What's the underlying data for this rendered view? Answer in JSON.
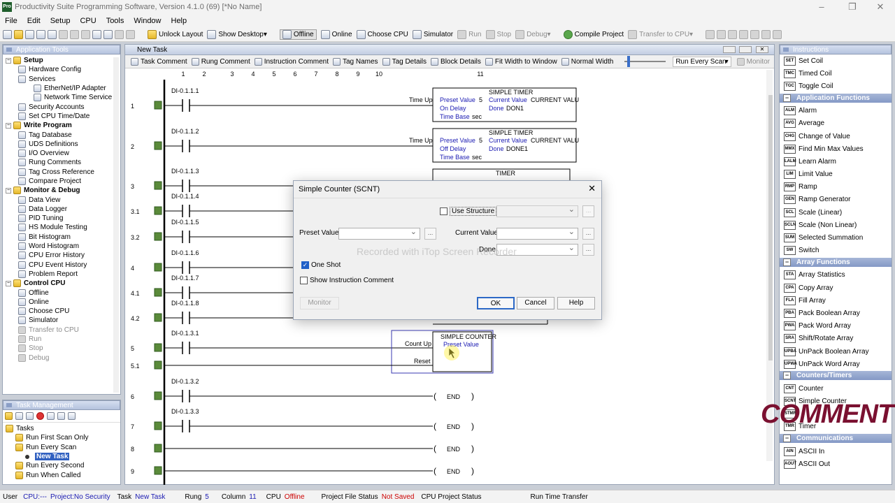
{
  "window": {
    "title": "Productivity Suite Programming Software, Version 4.1.0 (69)   [*No Name]",
    "app_icon": "Pro"
  },
  "menu": [
    "File",
    "Edit",
    "Setup",
    "CPU",
    "Tools",
    "Window",
    "Help"
  ],
  "toolbar": {
    "unlock_layout": "Unlock Layout",
    "show_desktop": "Show Desktop",
    "offline": "Offline",
    "online": "Online",
    "choose_cpu": "Choose CPU",
    "simulator": "Simulator",
    "run": "Run",
    "stop": "Stop",
    "debug": "Debug",
    "compile": "Compile Project",
    "transfer": "Transfer to CPU"
  },
  "app_tools": {
    "title": "Application Tools",
    "items": [
      {
        "label": "Setup",
        "group": true
      },
      {
        "label": "Hardware Config",
        "group": false,
        "level": 2
      },
      {
        "label": "Services",
        "group": false,
        "level": 2
      },
      {
        "label": "EtherNet/IP Adapter",
        "group": false,
        "level": 3
      },
      {
        "label": "Network Time Service",
        "group": false,
        "level": 3
      },
      {
        "label": "Security Accounts",
        "group": false,
        "level": 2
      },
      {
        "label": "Set CPU Time/Date",
        "group": false,
        "level": 2
      },
      {
        "label": "Write Program",
        "group": true
      },
      {
        "label": "Tag Database",
        "group": false,
        "level": 2
      },
      {
        "label": "UDS Definitions",
        "group": false,
        "level": 2
      },
      {
        "label": "I/O Overview",
        "group": false,
        "level": 2
      },
      {
        "label": "Rung Comments",
        "group": false,
        "level": 2
      },
      {
        "label": "Tag Cross Reference",
        "group": false,
        "level": 2
      },
      {
        "label": "Compare Project",
        "group": false,
        "level": 2
      },
      {
        "label": "Monitor & Debug",
        "group": true
      },
      {
        "label": "Data View",
        "group": false,
        "level": 2
      },
      {
        "label": "Data Logger",
        "group": false,
        "level": 2
      },
      {
        "label": "PID Tuning",
        "group": false,
        "level": 2
      },
      {
        "label": "HS Module Testing",
        "group": false,
        "level": 2
      },
      {
        "label": "Bit Histogram",
        "group": false,
        "level": 2
      },
      {
        "label": "Word Histogram",
        "group": false,
        "level": 2
      },
      {
        "label": "CPU Error History",
        "group": false,
        "level": 2
      },
      {
        "label": "CPU Event History",
        "group": false,
        "level": 2
      },
      {
        "label": "Problem Report",
        "group": false,
        "level": 2
      },
      {
        "label": "Control CPU",
        "group": true
      },
      {
        "label": "Offline",
        "group": false,
        "level": 2
      },
      {
        "label": "Online",
        "group": false,
        "level": 2
      },
      {
        "label": "Choose CPU",
        "group": false,
        "level": 2
      },
      {
        "label": "Simulator",
        "group": false,
        "level": 2
      },
      {
        "label": "Transfer to CPU",
        "group": false,
        "level": 2,
        "disabled": true
      },
      {
        "label": "Run",
        "group": false,
        "level": 2,
        "disabled": true
      },
      {
        "label": "Stop",
        "group": false,
        "level": 2,
        "disabled": true
      },
      {
        "label": "Debug",
        "group": false,
        "level": 2,
        "disabled": true
      }
    ]
  },
  "task_mgmt": {
    "title": "Task Management",
    "items": [
      {
        "label": "Tasks",
        "level": 1
      },
      {
        "label": "Run First Scan Only",
        "level": 2
      },
      {
        "label": "Run Every Scan",
        "level": 2
      },
      {
        "label": "New Task",
        "level": 3,
        "selected": true
      },
      {
        "label": "Run Every Second",
        "level": 2
      },
      {
        "label": "Run When Called",
        "level": 2
      }
    ]
  },
  "editor": {
    "title": "New Task",
    "toolbar": [
      "Task Comment",
      "Rung Comment",
      "Instruction Comment",
      "Tag Names",
      "Tag Details",
      "Block Details",
      "Fit Width to Window",
      "Normal Width"
    ],
    "scan_select": "Run Every Scan",
    "monitor": "Monitor",
    "columns": [
      "1",
      "2",
      "3",
      "4",
      "5",
      "6",
      "7",
      "8",
      "9",
      "10",
      "11"
    ],
    "rungs": [
      {
        "num": "1",
        "contact": "DI-0.1.1.1"
      },
      {
        "num": "2",
        "contact": "DI-0.1.1.2"
      },
      {
        "num": "3",
        "contact": "DI-0.1.1.3"
      },
      {
        "num": "3.1",
        "contact": "DI-0.1.1.4"
      },
      {
        "num": "3.2",
        "contact": "DI-0.1.1.5"
      },
      {
        "num": "4",
        "contact": "DI-0.1.1.6"
      },
      {
        "num": "4.1",
        "contact": "DI-0.1.1.7"
      },
      {
        "num": "4.2",
        "contact": "DI-0.1.1.8"
      },
      {
        "num": "5",
        "contact": "DI-0.1.3.1"
      },
      {
        "num": "5.1",
        "contact": ""
      },
      {
        "num": "6",
        "contact": "DI-0.1.3.2"
      },
      {
        "num": "7",
        "contact": "DI-0.1.3.3"
      },
      {
        "num": "8",
        "contact": ""
      },
      {
        "num": "9",
        "contact": ""
      }
    ],
    "timer1": {
      "title": "SIMPLE TIMER",
      "preset": "Preset Value",
      "preset_val": "5",
      "current": "Current Value",
      "current_val": "CURRENT VALU",
      "mode": "On Delay",
      "done": "Done",
      "done_val": "DON1",
      "timebase": "Time Base",
      "timebase_val": "sec",
      "output": "Time Up"
    },
    "timer2": {
      "title": "SIMPLE TIMER",
      "preset": "Preset Value",
      "preset_val": "5",
      "current": "Current Value",
      "current_val": "CURRENT VALU",
      "mode": "Off Delay",
      "done": "Done",
      "done_val": "DONE1",
      "timebase": "Time Base",
      "timebase_val": "sec",
      "output": "Time Up"
    },
    "timer3": {
      "title": "TIMER",
      "output": "Time Up"
    },
    "counter": {
      "title": "SIMPLE COUNTER",
      "preset": "Preset Value",
      "count_up": "Count Up",
      "reset": "Reset"
    },
    "end_label": "END"
  },
  "dialog": {
    "title": "Simple Counter (SCNT)",
    "use_structure": "Use Structure",
    "preset_label": "Preset Value",
    "current_label": "Current Value",
    "done_label": "Done",
    "one_shot": "One Shot",
    "show_comment": "Show Instruction Comment",
    "monitor": "Monitor",
    "ok": "OK",
    "cancel": "Cancel",
    "help": "Help",
    "ellipsis": "...",
    "watermark": "Recorded with iTop Screen Recorder"
  },
  "instructions": {
    "title": "Instructions",
    "sections": [
      {
        "title": "",
        "items": [
          {
            "badge": "SET",
            "label": "Set Coil"
          },
          {
            "badge": "TMC",
            "label": "Timed Coil"
          },
          {
            "badge": "TGC",
            "label": "Toggle Coil"
          }
        ]
      },
      {
        "title": "Application Functions",
        "items": [
          {
            "badge": "ALM",
            "label": "Alarm"
          },
          {
            "badge": "AVG",
            "label": "Average"
          },
          {
            "badge": "CHG",
            "label": "Change of Value"
          },
          {
            "badge": "MMX",
            "label": "Find Min Max Values"
          },
          {
            "badge": "LALM",
            "label": "Learn Alarm"
          },
          {
            "badge": "LIM",
            "label": "Limit Value"
          },
          {
            "badge": "RMP",
            "label": "Ramp"
          },
          {
            "badge": "GEN",
            "label": "Ramp Generator"
          },
          {
            "badge": "SCL",
            "label": "Scale (Linear)"
          },
          {
            "badge": "SCLN",
            "label": "Scale (Non Linear)"
          },
          {
            "badge": "SUM",
            "label": "Selected Summation"
          },
          {
            "badge": "SW",
            "label": "Switch"
          }
        ]
      },
      {
        "title": "Array Functions",
        "items": [
          {
            "badge": "STA",
            "label": "Array Statistics"
          },
          {
            "badge": "CPA",
            "label": "Copy Array"
          },
          {
            "badge": "FLA",
            "label": "Fill Array"
          },
          {
            "badge": "PBA",
            "label": "Pack Boolean Array"
          },
          {
            "badge": "PWA",
            "label": "Pack Word Array"
          },
          {
            "badge": "SRA",
            "label": "Shift/Rotate Array"
          },
          {
            "badge": "UPBA",
            "label": "UnPack Boolean Array"
          },
          {
            "badge": "UPWA",
            "label": "UnPack Word Array"
          }
        ]
      },
      {
        "title": "Counters/Timers",
        "items": [
          {
            "badge": "CNT",
            "label": "Counter"
          },
          {
            "badge": "SCNT",
            "label": "Simple Counter"
          },
          {
            "badge": "STMR",
            "label": ""
          },
          {
            "badge": "TMR",
            "label": "Timer"
          }
        ]
      },
      {
        "title": "Communications",
        "items": [
          {
            "badge": "AIN",
            "label": "ASCII In"
          },
          {
            "badge": "AOUT",
            "label": "ASCII Out"
          }
        ]
      }
    ]
  },
  "overlay_text": "COMMENT",
  "status": {
    "user": "User",
    "cpu": "CPU:---",
    "project": "Project:No Security",
    "task_label": "Task",
    "task": "New Task",
    "rung_label": "Rung",
    "rung": "5",
    "column_label": "Column",
    "column": "11",
    "cpu_label": "CPU",
    "cpu_state": "Offline",
    "pfs_label": "Project File Status",
    "pfs": "Not Saved",
    "cps_label": "CPU Project Status",
    "rtt_label": "Run Time Transfer"
  },
  "colors": {
    "accent": "#1a1ab2",
    "offline": "#cc0000",
    "selection": "#3060c0",
    "overlay": "#7a1030"
  }
}
